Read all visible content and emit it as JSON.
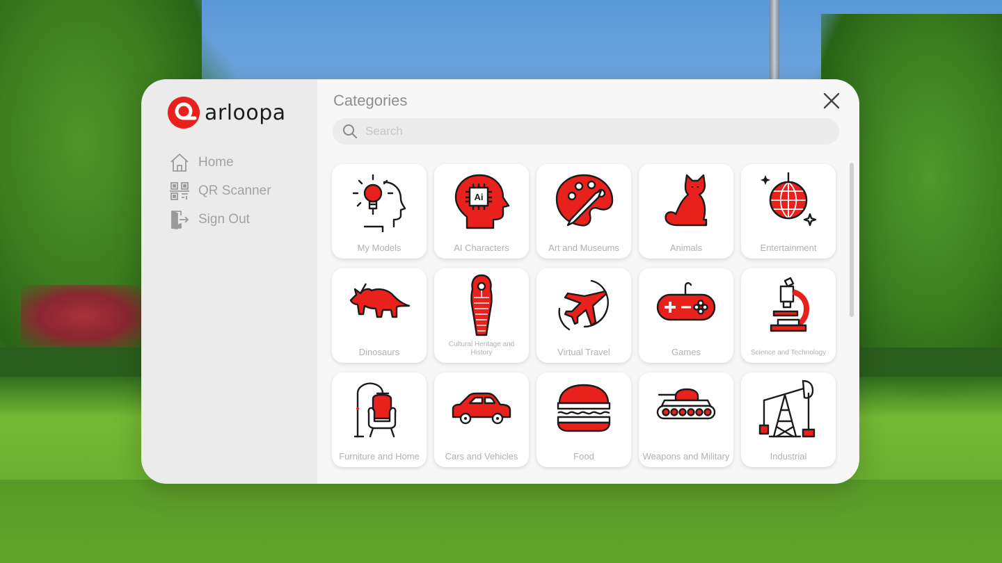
{
  "app": {
    "logo_text": "arloopa"
  },
  "sidebar": {
    "items": [
      {
        "label": "Home",
        "icon": "home-icon"
      },
      {
        "label": "QR Scanner",
        "icon": "qr-code-icon"
      },
      {
        "label": "Sign Out",
        "icon": "sign-out-icon"
      }
    ]
  },
  "main": {
    "title": "Categories",
    "search": {
      "placeholder": "Search",
      "value": ""
    },
    "categories": [
      {
        "label": "My Models",
        "icon": "lightbulb-head-icon"
      },
      {
        "label": "AI Characters",
        "icon": "ai-head-icon"
      },
      {
        "label": "Art and Museums",
        "icon": "paint-palette-icon"
      },
      {
        "label": "Animals",
        "icon": "cat-icon"
      },
      {
        "label": "Entertainment",
        "icon": "disco-ball-icon"
      },
      {
        "label": "Dinosaurs",
        "icon": "triceratops-icon"
      },
      {
        "label": "Cultural Heritage and History",
        "icon": "sarcophagus-icon"
      },
      {
        "label": "Virtual Travel",
        "icon": "airplane-icon"
      },
      {
        "label": "Games",
        "icon": "gamepad-icon"
      },
      {
        "label": "Science and Technology",
        "icon": "microscope-icon"
      },
      {
        "label": "Furniture and Home",
        "icon": "armchair-lamp-icon"
      },
      {
        "label": "Cars and Vehicles",
        "icon": "car-icon"
      },
      {
        "label": "Food",
        "icon": "burger-icon"
      },
      {
        "label": "Weapons and Military",
        "icon": "tank-icon"
      },
      {
        "label": "Industrial",
        "icon": "oil-pump-icon"
      }
    ]
  },
  "colors": {
    "accent": "#e8211d",
    "outline": "#1a1a1a",
    "label_gray": "#b1b1b1"
  }
}
